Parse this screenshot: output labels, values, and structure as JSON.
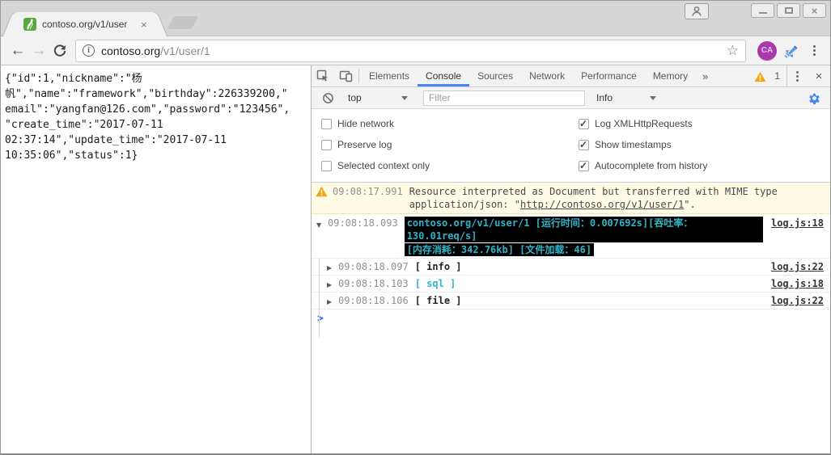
{
  "colors": {
    "accent": "#4285f4",
    "ansi-cyan": "#2fb5c9",
    "ansi-bg": "#000000",
    "warn-bg": "#fffbe5",
    "prompt-blue": "#2a6df5",
    "favicon-green": "#58a942",
    "ext-badge-purple": "#a93aac",
    "warning-triangle": "#f2a60d"
  },
  "titlebar": {
    "tab_title": "contoso.org/v1/user",
    "tab_close": "×",
    "window_controls": [
      "minimize",
      "maximize",
      "close"
    ]
  },
  "address_bar": {
    "back": "←",
    "forward": "→",
    "url_host": "contoso.org",
    "url_path": "/v1/user/1",
    "star": "☆",
    "extension_badge": "CA"
  },
  "page": {
    "lines": [
      "{\"id\":1,\"nickname\":\"杨",
      "帆\",\"name\":\"framework\",\"birthday\":226339200,\"",
      "email\":\"yangfan@126.com\",\"password\":\"123456\",",
      "\"create_time\":\"2017-07-11",
      "02:37:14\",\"update_time\":\"2017-07-11",
      "10:35:06\",\"status\":1}"
    ]
  },
  "devtools": {
    "tabs": [
      "Elements",
      "Console",
      "Sources",
      "Network",
      "Performance",
      "Memory"
    ],
    "active_tab": "Console",
    "overflow_label": "»",
    "warning_count": "1",
    "close_label": "×",
    "console_toolbar": {
      "context": "top",
      "filter_placeholder": "Filter",
      "level": "Info"
    },
    "settings": {
      "left": [
        "Hide network",
        "Preserve log",
        "Selected context only"
      ],
      "right": [
        "Log XMLHttpRequests",
        "Show timestamps",
        "Autocomplete from history"
      ]
    },
    "messages": {
      "warning": {
        "timestamp": "09:08:17.991",
        "line1": "Resource interpreted as Document but transferred with MIME type",
        "line2_prefix": "application/json: \"",
        "link": "http://contoso.org/v1/user/1",
        "line2_suffix": "\"."
      },
      "group": {
        "timestamp": "09:08:18.093",
        "line1": "contoso.org/v1/user/1 [运行时间：0.007692s][吞吐率：130.01req/s]",
        "line2": "[内存消耗：342.76kb] [文件加载：46]",
        "source": "log.js:18"
      },
      "children": [
        {
          "timestamp": "09:08:18.097",
          "label": "[ info ]",
          "source": "log.js:22"
        },
        {
          "timestamp": "09:08:18.103",
          "label": "[ sql ]",
          "source": "log.js:18"
        },
        {
          "timestamp": "09:08:18.106",
          "label": "[ file ]",
          "source": "log.js:22"
        }
      ],
      "prompt_symbol": ">"
    }
  }
}
